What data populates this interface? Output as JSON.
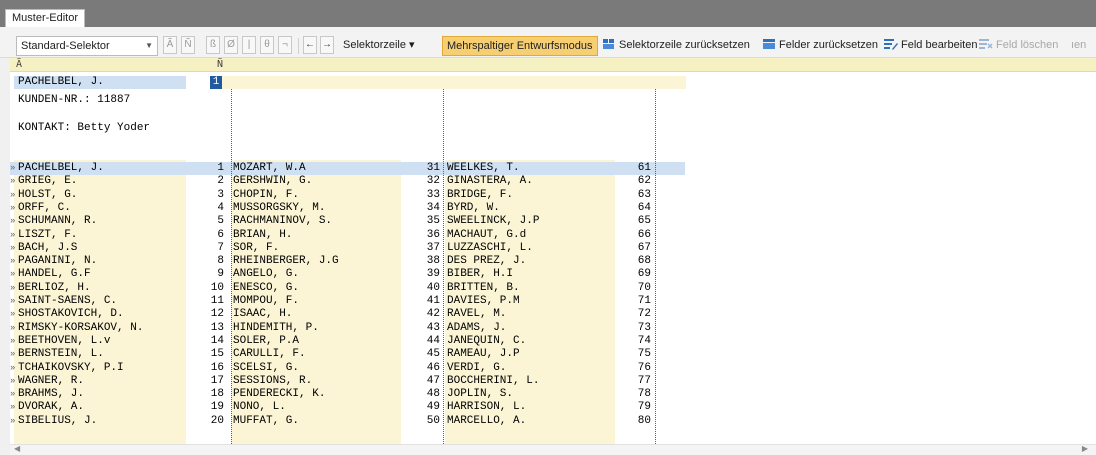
{
  "window": {
    "tab_label": "Muster-Editor"
  },
  "toolbar": {
    "selector_value": "Standard-Selektor",
    "symbols": [
      "Ã",
      "Ñ",
      "ß",
      "Ø",
      "|",
      "θ",
      "¬"
    ],
    "arrow_left": "←",
    "arrow_right": "→",
    "selector_row_label": "Selektorzeile ▾",
    "multi_column_label": "Mehrspaltiger Entwurfsmodus",
    "reset_selector_label": "Selektorzeile zurücksetzen",
    "reset_fields_label": "Felder zurücksetzen",
    "edit_field_label": "Feld bearbeiten",
    "delete_field_label": "Feld löschen",
    "overflow_label": "ıen"
  },
  "ruler": {
    "mark_a": "Ã",
    "mark_n": "Ñ"
  },
  "header": {
    "name": "PACHELBEL, J.",
    "num": "1",
    "customer_line": "KUNDEN-NR.: 11887",
    "contact_line": "KONTAKT: Betty Yoder"
  },
  "rows": [
    {
      "c1": "PACHELBEL, J.",
      "n1": "1",
      "c2": "MOZART, W.A",
      "n2": "31",
      "c3": "WEELKES, T.",
      "n3": "61"
    },
    {
      "c1": "GRIEG, E.",
      "n1": "2",
      "c2": "GERSHWIN, G.",
      "n2": "32",
      "c3": "GINASTERA, A.",
      "n3": "62"
    },
    {
      "c1": "HOLST, G.",
      "n1": "3",
      "c2": "CHOPIN, F.",
      "n2": "33",
      "c3": "BRIDGE, F.",
      "n3": "63"
    },
    {
      "c1": "ORFF, C.",
      "n1": "4",
      "c2": "MUSSORGSKY, M.",
      "n2": "34",
      "c3": "BYRD, W.",
      "n3": "64"
    },
    {
      "c1": "SCHUMANN, R.",
      "n1": "5",
      "c2": "RACHMANINOV, S.",
      "n2": "35",
      "c3": "SWEELINCK, J.P",
      "n3": "65"
    },
    {
      "c1": "LISZT, F.",
      "n1": "6",
      "c2": "BRIAN, H.",
      "n2": "36",
      "c3": "MACHAUT, G.d",
      "n3": "66"
    },
    {
      "c1": "BACH, J.S",
      "n1": "7",
      "c2": "SOR, F.",
      "n2": "37",
      "c3": "LUZZASCHI, L.",
      "n3": "67"
    },
    {
      "c1": "PAGANINI, N.",
      "n1": "8",
      "c2": "RHEINBERGER, J.G",
      "n2": "38",
      "c3": "DES PREZ, J.",
      "n3": "68"
    },
    {
      "c1": "HANDEL, G.F",
      "n1": "9",
      "c2": "ANGELO, G.",
      "n2": "39",
      "c3": "BIBER, H.I",
      "n3": "69"
    },
    {
      "c1": "BERLIOZ, H.",
      "n1": "10",
      "c2": "ENESCO, G.",
      "n2": "40",
      "c3": "BRITTEN, B.",
      "n3": "70"
    },
    {
      "c1": "SAINT-SAENS, C.",
      "n1": "11",
      "c2": "MOMPOU, F.",
      "n2": "41",
      "c3": "DAVIES, P.M",
      "n3": "71"
    },
    {
      "c1": "SHOSTAKOVICH, D.",
      "n1": "12",
      "c2": "ISAAC, H.",
      "n2": "42",
      "c3": "RAVEL, M.",
      "n3": "72"
    },
    {
      "c1": "RIMSKY-KORSAKOV, N.",
      "n1": "13",
      "c2": "HINDEMITH, P.",
      "n2": "43",
      "c3": "ADAMS, J.",
      "n3": "73"
    },
    {
      "c1": "BEETHOVEN, L.v",
      "n1": "14",
      "c2": "SOLER, P.A",
      "n2": "44",
      "c3": "JANEQUIN, C.",
      "n3": "74"
    },
    {
      "c1": "BERNSTEIN, L.",
      "n1": "15",
      "c2": "CARULLI, F.",
      "n2": "45",
      "c3": "RAMEAU, J.P",
      "n3": "75"
    },
    {
      "c1": "TCHAIKOVSKY, P.I",
      "n1": "16",
      "c2": "SCELSI, G.",
      "n2": "46",
      "c3": "VERDI, G.",
      "n3": "76"
    },
    {
      "c1": "WAGNER, R.",
      "n1": "17",
      "c2": "SESSIONS, R.",
      "n2": "47",
      "c3": "BOCCHERINI, L.",
      "n3": "77"
    },
    {
      "c1": "BRAHMS, J.",
      "n1": "18",
      "c2": "PENDERECKI, K.",
      "n2": "48",
      "c3": "JOPLIN, S.",
      "n3": "78"
    },
    {
      "c1": "DVORAK, A.",
      "n1": "19",
      "c2": "NONO, L.",
      "n2": "49",
      "c3": "HARRISON, L.",
      "n3": "79"
    },
    {
      "c1": "SIBELIUS, J.",
      "n1": "20",
      "c2": "MUFFAT, G.",
      "n2": "50",
      "c3": "MARCELLO, A.",
      "n3": "80"
    }
  ],
  "row_marker": "»",
  "scroll": {
    "left": "◀",
    "right": "▶"
  }
}
